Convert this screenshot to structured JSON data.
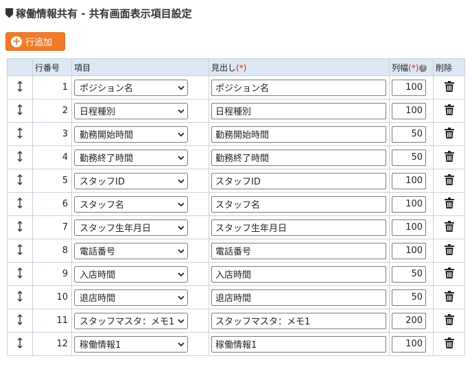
{
  "title": "稼働情報共有 - 共有画面表示項目設定",
  "add_button_label": "行追加",
  "columns": {
    "row_number": "行番号",
    "item": "項目",
    "heading": "見出し",
    "heading_required": "(*)",
    "width": "列幅",
    "width_required": "(*)",
    "delete": "削除"
  },
  "rows": [
    {
      "no": "1",
      "item": "ポジション名",
      "heading": "ポジション名",
      "width": "100"
    },
    {
      "no": "2",
      "item": "日程種別",
      "heading": "日程種別",
      "width": "100"
    },
    {
      "no": "3",
      "item": "勤務開始時間",
      "heading": "勤務開始時間",
      "width": "50"
    },
    {
      "no": "4",
      "item": "勤務終了時間",
      "heading": "勤務終了時間",
      "width": "50"
    },
    {
      "no": "5",
      "item": "スタッフID",
      "heading": "スタッフID",
      "width": "100"
    },
    {
      "no": "6",
      "item": "スタッフ名",
      "heading": "スタッフ名",
      "width": "100"
    },
    {
      "no": "7",
      "item": "スタッフ生年月日",
      "heading": "スタッフ生年月日",
      "width": "100"
    },
    {
      "no": "8",
      "item": "電話番号",
      "heading": "電話番号",
      "width": "100"
    },
    {
      "no": "9",
      "item": "入店時間",
      "heading": "入店時間",
      "width": "50"
    },
    {
      "no": "10",
      "item": "退店時間",
      "heading": "退店時間",
      "width": "50"
    },
    {
      "no": "11",
      "item": "スタッフマスタ：メモ1",
      "heading": "スタッフマスタ：メモ1",
      "width": "200"
    },
    {
      "no": "12",
      "item": "稼働情報1",
      "heading": "稼働情報1",
      "width": "100"
    }
  ],
  "icons": {
    "title_icon": "shield-icon",
    "add_icon": "plus-circle-icon",
    "drag_icon": "drag-handle-icon",
    "help_icon": "help-icon",
    "delete_icon": "trash-icon",
    "select_icon": "chevron-down-icon"
  },
  "colors": {
    "accent": "#f07c2a",
    "header_bg": "#dde8f5",
    "required": "#e0201b"
  }
}
